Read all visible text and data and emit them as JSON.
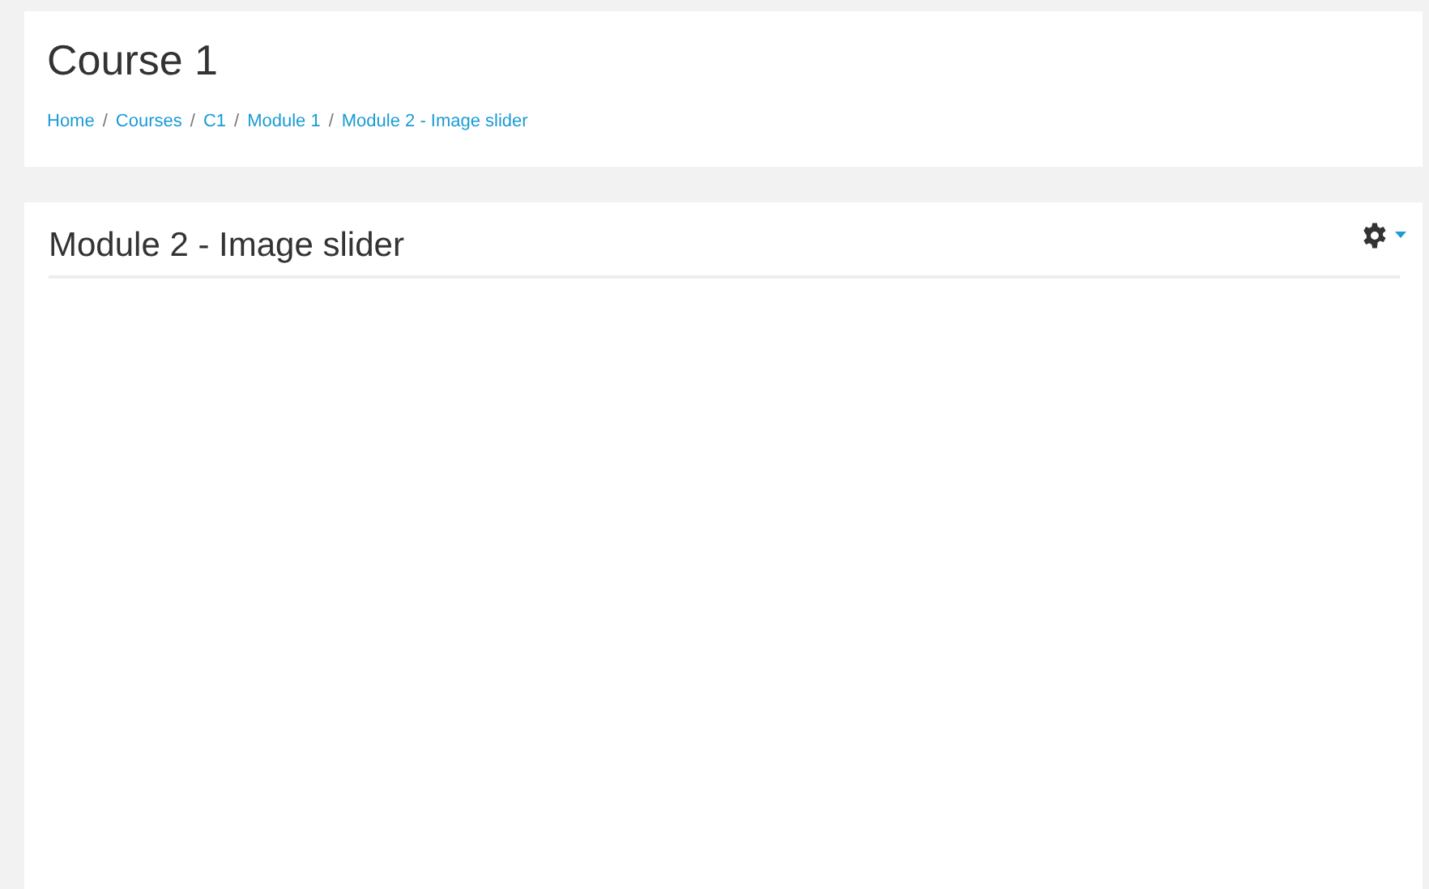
{
  "header": {
    "title": "Course 1",
    "breadcrumb_separator": "/",
    "breadcrumb": [
      {
        "label": "Home"
      },
      {
        "label": "Courses"
      },
      {
        "label": "C1"
      },
      {
        "label": "Module 1"
      },
      {
        "label": "Module 2 - Image slider"
      }
    ]
  },
  "main": {
    "title": "Module 2 - Image slider"
  }
}
